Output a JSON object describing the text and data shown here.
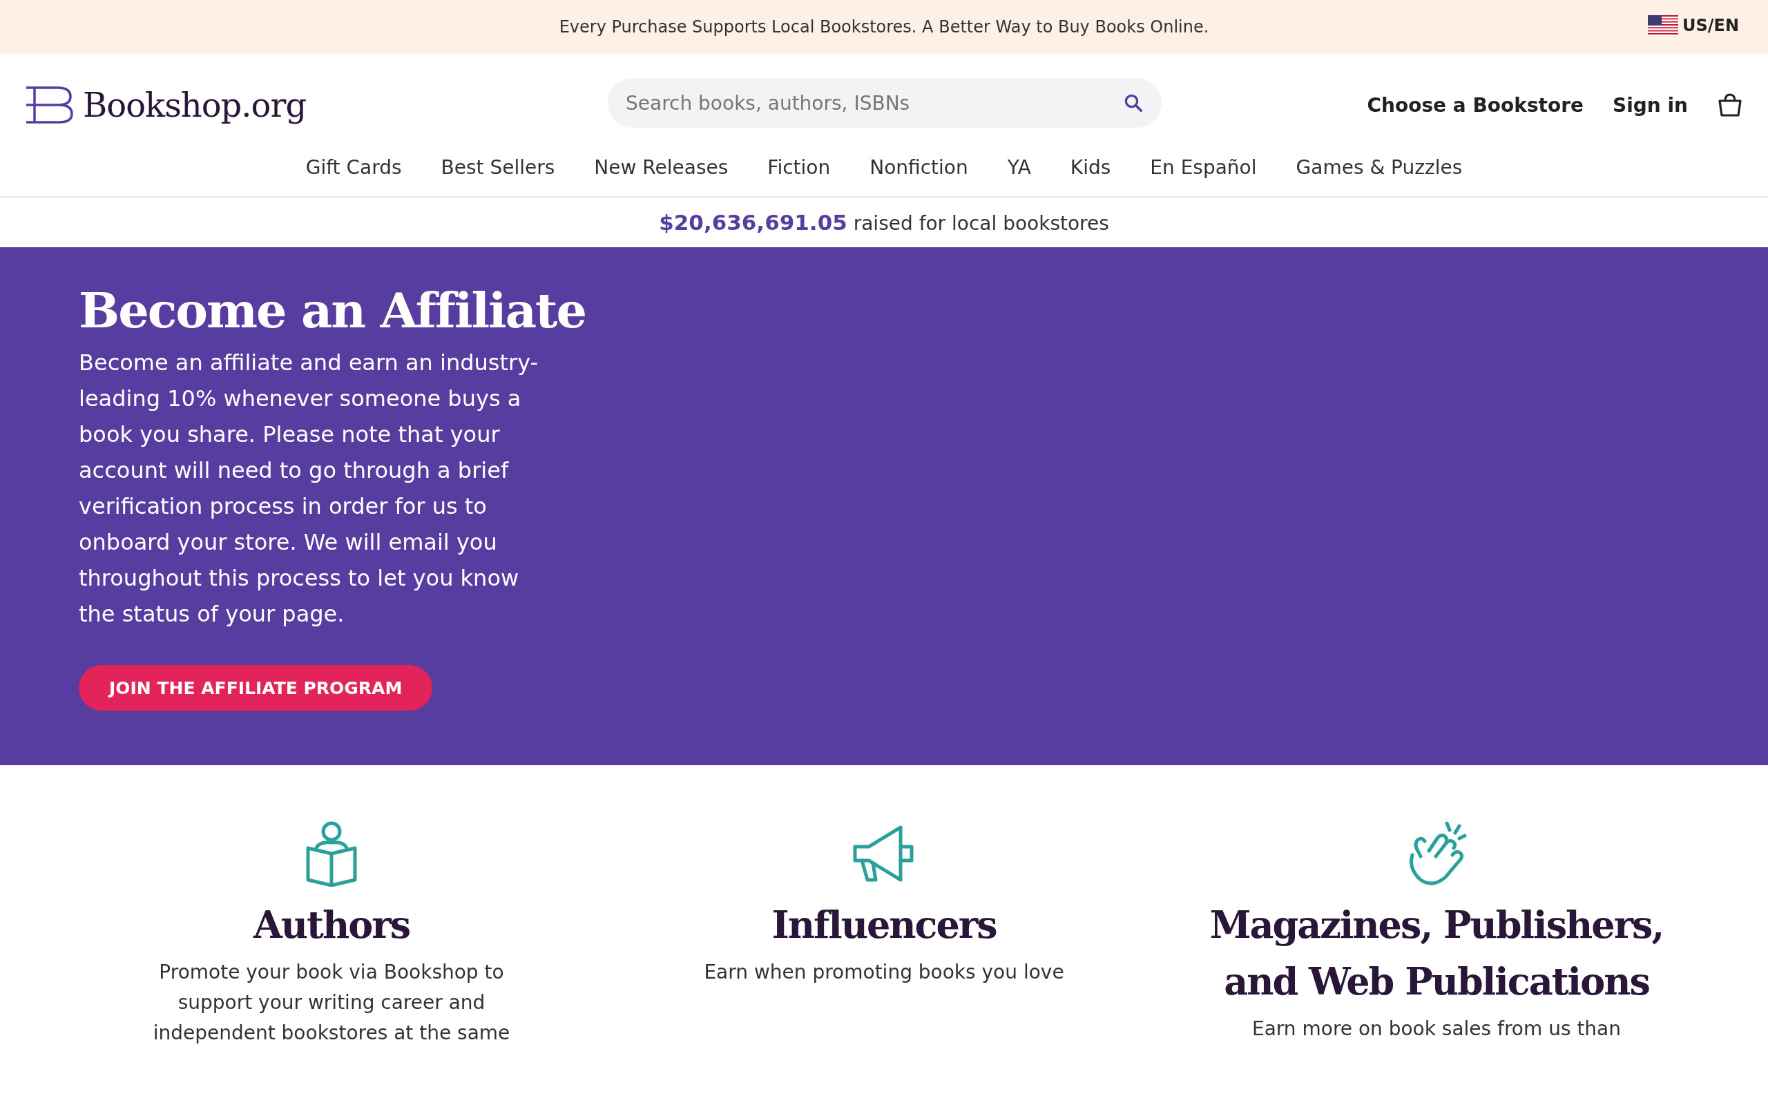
{
  "promo_bar": {
    "message": "Every Purchase Supports Local Bookstores. A Better Way to Buy Books Online.",
    "locale": "US/EN"
  },
  "header": {
    "logo": "Bookshop.org",
    "search": {
      "placeholder": "Search books, authors, ISBNs"
    },
    "links": [
      "Choose a Bookstore",
      "Sign in"
    ]
  },
  "nav": [
    "Gift Cards",
    "Best Sellers",
    "New Releases",
    "Fiction",
    "Nonfiction",
    "YA",
    "Kids",
    "En Español",
    "Games & Puzzles"
  ],
  "raised": {
    "amount": "$20,636,691.05",
    "text": "raised for local bookstores"
  },
  "hero": {
    "title": "Become an Affiliate",
    "body": "Become an affiliate and earn an industry-leading 10% whenever someone buys a book you share. Please note that your account will need to go through a brief verification process in order for us to onboard your store. We will email you throughout this process to let you know the status of your page.",
    "button": "JOIN THE AFFILIATE PROGRAM"
  },
  "audiences": [
    {
      "kind": "author",
      "title": "Authors",
      "description": "Promote your book via Bookshop to support your writing career and independent bookstores at the same"
    },
    {
      "kind": "influencer",
      "title": "Influencers",
      "description": "Earn when promoting books you love"
    },
    {
      "kind": "publisher",
      "title": "Magazines, Publishers, and Web Publications",
      "description": "Earn more on book sales from us than"
    }
  ]
}
